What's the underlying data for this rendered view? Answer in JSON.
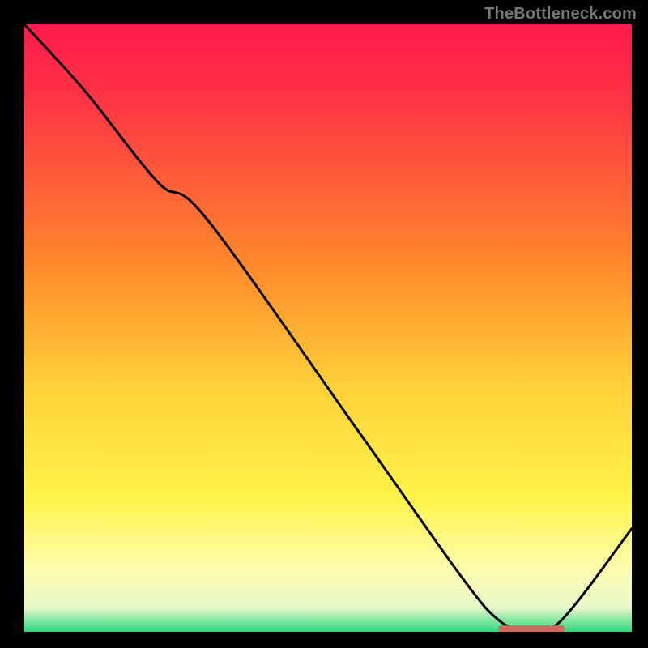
{
  "watermark": "TheBottleneck.com",
  "chart_data": {
    "type": "line",
    "title": "",
    "xlabel": "",
    "ylabel": "",
    "xlim": [
      0,
      100
    ],
    "ylim": [
      0,
      100
    ],
    "grid": false,
    "gradient_stops": [
      {
        "pos": 0.0,
        "color": "#ff1a4b"
      },
      {
        "pos": 0.12,
        "color": "#ff3345"
      },
      {
        "pos": 0.4,
        "color": "#ff8a2a"
      },
      {
        "pos": 0.6,
        "color": "#ffd23a"
      },
      {
        "pos": 0.78,
        "color": "#fff44a"
      },
      {
        "pos": 0.9,
        "color": "#fdfdb0"
      },
      {
        "pos": 0.96,
        "color": "#e8f7c9"
      },
      {
        "pos": 1.0,
        "color": "#2bd97c"
      }
    ],
    "curve": {
      "x": [
        0.0,
        10.0,
        22.0,
        30.0,
        55.0,
        72.0,
        78.0,
        82.0,
        88.0,
        100.0
      ],
      "values": [
        100.0,
        89.0,
        74.0,
        68.0,
        33.0,
        9.0,
        2.0,
        0.5,
        1.5,
        17.0
      ]
    },
    "flat_marker": {
      "x_start": 78.0,
      "x_end": 89.0,
      "y": 0.5,
      "color": "#d26a5c"
    }
  }
}
